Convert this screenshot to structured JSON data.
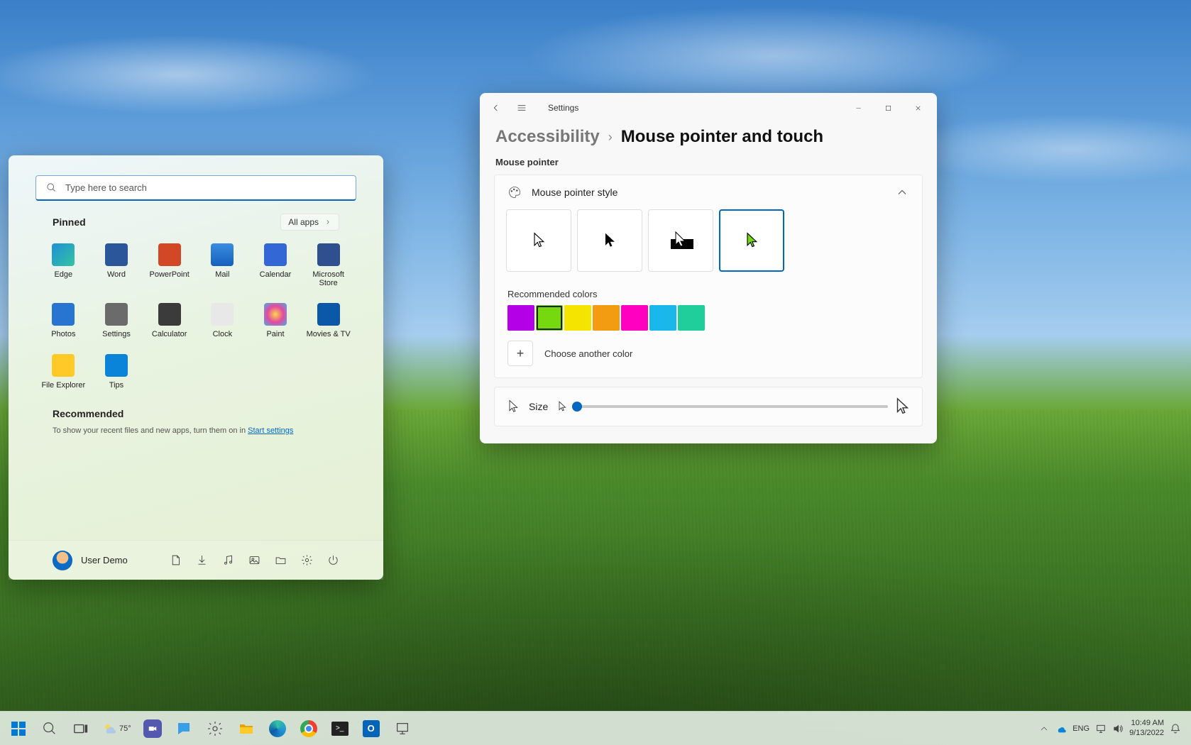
{
  "start_menu": {
    "search_placeholder": "Type here to search",
    "pinned_label": "Pinned",
    "all_apps_label": "All apps",
    "apps": [
      {
        "label": "Edge",
        "color": "linear-gradient(135deg,#1e90d4,#34c3a3)"
      },
      {
        "label": "Word",
        "color": "#2b579a"
      },
      {
        "label": "PowerPoint",
        "color": "#d24726"
      },
      {
        "label": "Mail",
        "color": "linear-gradient(#3a8de0,#1560bd)"
      },
      {
        "label": "Calendar",
        "color": "#3367d6"
      },
      {
        "label": "Microsoft Store",
        "color": "#2f4f8f"
      },
      {
        "label": "Photos",
        "color": "#2775d0"
      },
      {
        "label": "Settings",
        "color": "#6b6b6b"
      },
      {
        "label": "Calculator",
        "color": "#3b3b3b"
      },
      {
        "label": "Clock",
        "color": "#e8e8e8"
      },
      {
        "label": "Paint",
        "color": "radial-gradient(circle,#ffd54a,#e24aa0,#4ab0e2)"
      },
      {
        "label": "Movies & TV",
        "color": "#0b58a8"
      },
      {
        "label": "File Explorer",
        "color": "#ffca28"
      },
      {
        "label": "Tips",
        "color": "#0a84d8"
      }
    ],
    "recommended_label": "Recommended",
    "recommended_text": "To show your recent files and new apps, turn them on in ",
    "recommended_link": "Start settings",
    "user_name": "User Demo"
  },
  "settings": {
    "app_title": "Settings",
    "breadcrumb_parent": "Accessibility",
    "breadcrumb_current": "Mouse pointer and touch",
    "group_label": "Mouse pointer",
    "style_label": "Mouse pointer style",
    "recommended_colors_label": "Recommended colors",
    "colors": [
      "#b400e6",
      "#76d80e",
      "#f4e400",
      "#f39c12",
      "#ff00c1",
      "#19b7ea",
      "#1fce9a"
    ],
    "selected_color_index": 1,
    "choose_another_label": "Choose another color",
    "size_label": "Size"
  },
  "taskbar": {
    "weather_temp": "75°",
    "lang": "ENG",
    "time": "10:49 AM",
    "date": "9/13/2022"
  }
}
